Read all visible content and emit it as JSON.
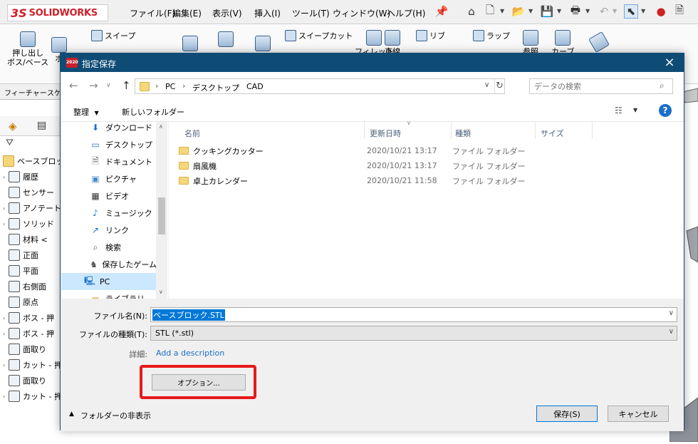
{
  "app": {
    "logo_ds": "3S",
    "logo_text": "SOLIDWORKS",
    "menu": [
      "ファイル(F)",
      "編集(E)",
      "表示(V)",
      "挿入(I)",
      "ツール(T)",
      "ウィンドウ(W)",
      "ヘルプ(H)"
    ]
  },
  "ribbon": {
    "extrude_boss_label1": "押し出し",
    "extrude_boss_label2": "ボス/ベース",
    "boss_partial": "ボ",
    "sweep": "スイープ",
    "sweep_cut": "スイープカット",
    "rib": "リブ",
    "wrap": "ラップ",
    "fillet": "フィレット",
    "linear": "直線",
    "reference": "参照",
    "curves": "カーブ"
  },
  "cm_tabs": [
    "フィーチャー",
    "スケ"
  ],
  "tree": {
    "root": "ベースブロック",
    "items": [
      {
        "label": "履歴",
        "expand": true
      },
      {
        "label": "センサー",
        "expand": false
      },
      {
        "label": "アノテート",
        "expand": true
      },
      {
        "label": "ソリッド",
        "expand": true
      },
      {
        "label": "材料 <",
        "expand": false
      },
      {
        "label": "正面",
        "expand": false
      },
      {
        "label": "平面",
        "expand": false
      },
      {
        "label": "右側面",
        "expand": false
      },
      {
        "label": "原点",
        "expand": false
      },
      {
        "label": "ボス - 押",
        "expand": true
      },
      {
        "label": "ボス - 押",
        "expand": true
      },
      {
        "label": "面取り",
        "expand": false
      },
      {
        "label": "カット - 押",
        "expand": true
      },
      {
        "label": "面取り",
        "expand": false
      },
      {
        "label": "カット - 押",
        "expand": true
      }
    ]
  },
  "dialog": {
    "title": "指定保存",
    "icon_text": "2020",
    "close": "×",
    "breadcrumb": [
      "PC",
      "デスクトップ",
      "CAD"
    ],
    "search_placeholder": "データの検索",
    "organize": "整理",
    "new_folder": "新しいフォルダー",
    "help": "?",
    "nav_items": [
      {
        "label": "ダウンロード",
        "icon": "download-icon"
      },
      {
        "label": "デスクトップ",
        "icon": "desktop-icon"
      },
      {
        "label": "ドキュメント",
        "icon": "document-icon"
      },
      {
        "label": "ピクチャ",
        "icon": "picture-icon"
      },
      {
        "label": "ビデオ",
        "icon": "video-icon"
      },
      {
        "label": "ミュージック",
        "icon": "music-icon"
      },
      {
        "label": "リンク",
        "icon": "link-icon"
      },
      {
        "label": "検索",
        "icon": "search-icon"
      },
      {
        "label": "保存したゲーム",
        "icon": "saved-games-icon"
      },
      {
        "label": "PC",
        "icon": "pc-icon"
      },
      {
        "label": "ライブラリ",
        "icon": "library-icon"
      }
    ],
    "columns": [
      "名前",
      "更新日時",
      "種類",
      "サイズ"
    ],
    "files": [
      {
        "name": "クッキングカッター",
        "date": "2020/10/21 13:17",
        "type": "ファイル フォルダー"
      },
      {
        "name": "扇風機",
        "date": "2020/10/21 13:17",
        "type": "ファイル フォルダー"
      },
      {
        "name": "卓上カレンダー",
        "date": "2020/10/21 11:58",
        "type": "ファイル フォルダー"
      }
    ],
    "filename_label": "ファイル名(N):",
    "filename_value": "ベースブロック.STL",
    "filetype_label": "ファイルの種類(T):",
    "filetype_value": "STL (*.stl)",
    "details_label": "詳細:",
    "details_link": "Add a description",
    "options_button": "オプション...",
    "hide_folders": "フォルダーの非表示",
    "save_button": "保存(S)",
    "cancel_button": "キャンセル"
  }
}
